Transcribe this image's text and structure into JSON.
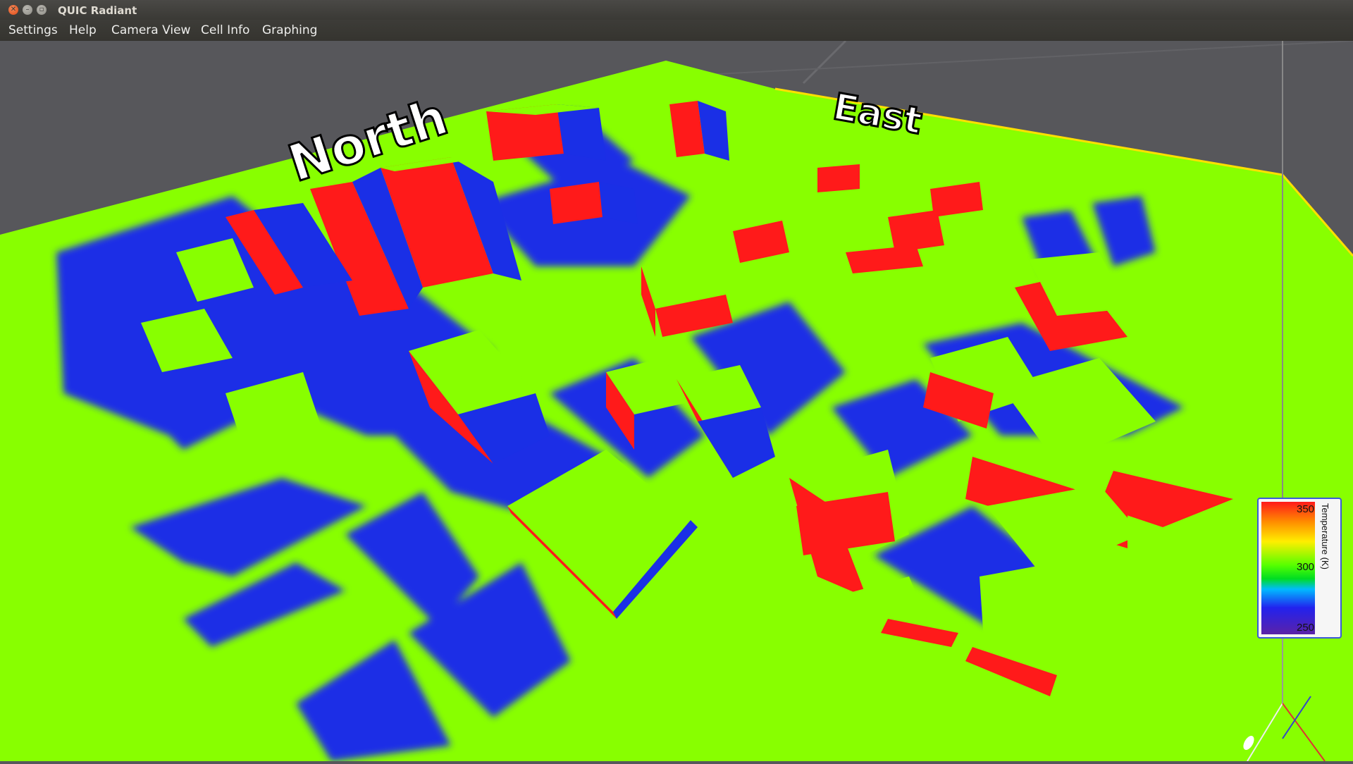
{
  "window": {
    "title": "QUIC Radiant"
  },
  "menu": [
    {
      "id": "settings",
      "label": "Settings"
    },
    {
      "id": "help",
      "label": "Help"
    },
    {
      "id": "camera-view",
      "label": "Camera View"
    },
    {
      "id": "cell-info",
      "label": "Cell Info"
    },
    {
      "id": "graphing",
      "label": "Graphing"
    }
  ],
  "scene": {
    "compass": {
      "north": "North",
      "east": "East"
    },
    "colors": {
      "hot": "#ff1a1a",
      "neutral": "#88ff00",
      "cold": "#1a2fe6",
      "background": "#57575b"
    }
  },
  "legend": {
    "title": "Temperature (K)",
    "ticks": [
      "350",
      "300",
      "250"
    ],
    "min": 250,
    "max": 350
  },
  "icons": {
    "close": "close-icon",
    "minimize": "minimize-icon",
    "maximize": "maximize-icon",
    "axes": "axes-gizmo-icon"
  }
}
